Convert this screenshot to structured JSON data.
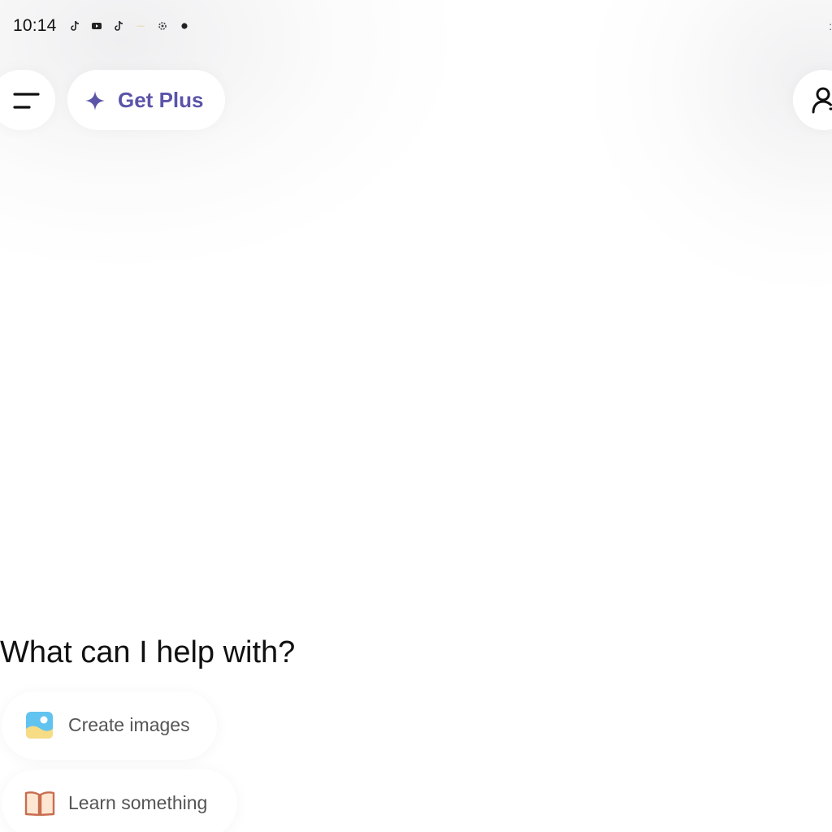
{
  "status_bar": {
    "time": "10:14",
    "notification_icons": [
      "tiktok-icon",
      "youtube-icon",
      "tiktok-icon",
      "dash-icon",
      "settings-icon",
      "dot-icon"
    ],
    "edge_text": ":"
  },
  "top_bar": {
    "menu_icon": "menu-icon",
    "get_plus_label": "Get Plus",
    "get_plus_icon": "sparkle-icon",
    "get_plus_color": "#5b54a8",
    "profile_icon": "add-person-icon"
  },
  "main": {
    "prompt": "What can I help with?",
    "suggestions": [
      {
        "label": "Create images",
        "icon": "image-icon"
      },
      {
        "label": "Learn something",
        "icon": "book-icon"
      }
    ]
  }
}
